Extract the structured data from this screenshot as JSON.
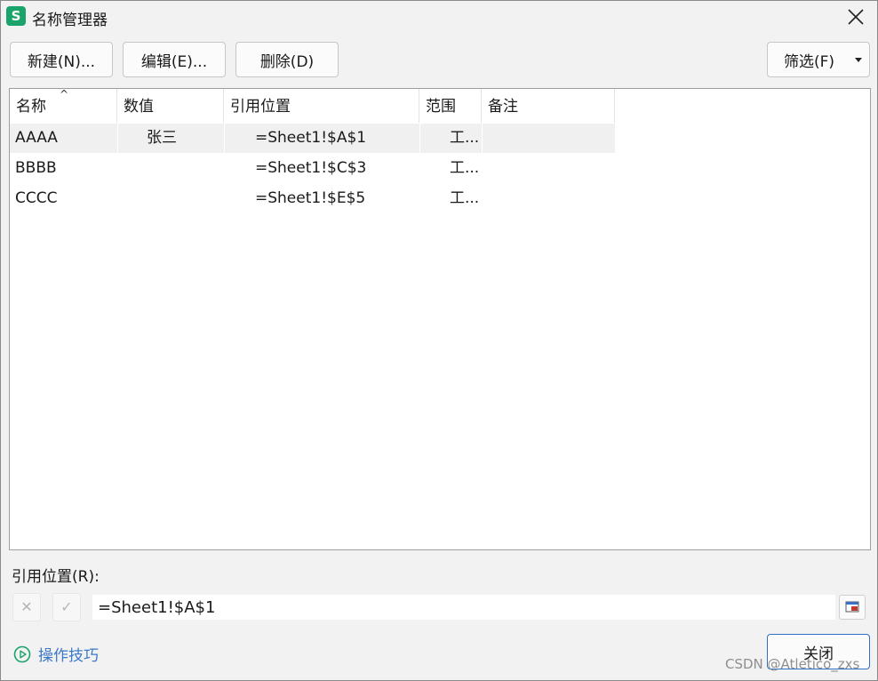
{
  "window": {
    "title": "名称管理器",
    "app_icon_letter": "S",
    "accent_color": "#1aa36a"
  },
  "toolbar": {
    "new_label": "新建(N)...",
    "edit_label": "编辑(E)...",
    "delete_label": "删除(D)",
    "filter_label": "筛选(F)"
  },
  "table": {
    "columns": [
      "名称",
      "数值",
      "引用位置",
      "范围",
      "备注"
    ],
    "sort_indicator": "^",
    "rows": [
      {
        "name": "AAAA",
        "value": "张三",
        "ref": "=Sheet1!$A$1",
        "scope": "工...",
        "note": ""
      },
      {
        "name": "BBBB",
        "value": "",
        "ref": "=Sheet1!$C$3",
        "scope": "工...",
        "note": ""
      },
      {
        "name": "CCCC",
        "value": "",
        "ref": "=Sheet1!$E$5",
        "scope": "工...",
        "note": ""
      }
    ]
  },
  "reference": {
    "label": "引用位置(R):",
    "value": "=Sheet1!$A$1",
    "cancel_symbol": "✕",
    "confirm_symbol": "✓"
  },
  "footer": {
    "tips_label": "操作技巧",
    "close_label": "关闭",
    "watermark": "CSDN @Atletico_zxs"
  }
}
